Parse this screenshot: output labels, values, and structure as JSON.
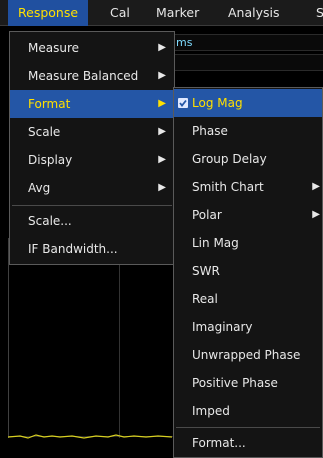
{
  "menubar": {
    "items": [
      {
        "label": "Response",
        "active": true
      },
      {
        "label": "Cal"
      },
      {
        "label": "Marker"
      },
      {
        "label": "Analysis"
      },
      {
        "label": "S"
      }
    ]
  },
  "background": {
    "strip_text": "ms"
  },
  "response_menu": {
    "items": [
      {
        "label": "Measure",
        "arrow": "▶"
      },
      {
        "label": "Measure Balanced",
        "arrow": "▶"
      },
      {
        "label": "Format",
        "arrow": "▶",
        "highlighted": true
      },
      {
        "label": "Scale",
        "arrow": "▶"
      },
      {
        "label": "Display",
        "arrow": "▶"
      },
      {
        "label": "Avg",
        "arrow": "▶"
      },
      {
        "label": "Scale..."
      },
      {
        "label": "IF Bandwidth..."
      }
    ]
  },
  "format_menu": {
    "items": [
      {
        "label": "Log Mag",
        "checked": true,
        "highlighted": true
      },
      {
        "label": "Phase"
      },
      {
        "label": "Group Delay"
      },
      {
        "label": "Smith Chart",
        "arrow": "▶"
      },
      {
        "label": "Polar",
        "arrow": "▶"
      },
      {
        "label": "Lin Mag"
      },
      {
        "label": "SWR"
      },
      {
        "label": "Real"
      },
      {
        "label": "Imaginary"
      },
      {
        "label": "Unwrapped Phase"
      },
      {
        "label": "Positive Phase"
      },
      {
        "label": "Imped"
      },
      {
        "label": "Format..."
      }
    ]
  },
  "colors": {
    "highlight": "#2456a6",
    "highlight_text": "#ffe000",
    "trace": "#d8d020"
  }
}
